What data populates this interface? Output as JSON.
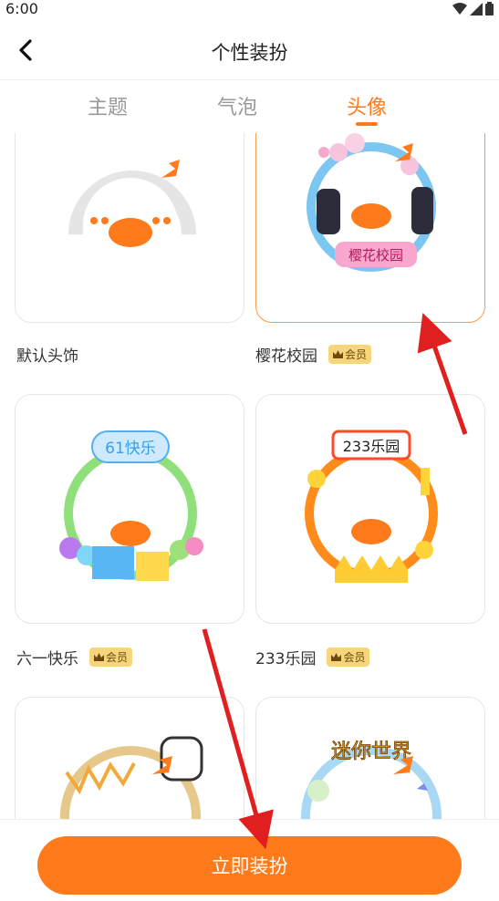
{
  "status_bar": {
    "time": "6:00"
  },
  "app_bar": {
    "title": "个性装扮"
  },
  "tabs": [
    {
      "label": "主题",
      "active": false
    },
    {
      "label": "气泡",
      "active": false
    },
    {
      "label": "头像",
      "active": true
    }
  ],
  "items": [
    {
      "name": "默认头饰",
      "vip": false,
      "selected": false,
      "ring_text": ""
    },
    {
      "name": "樱花校园",
      "vip": true,
      "selected": true,
      "ring_text": "樱花校园"
    },
    {
      "name": "六一快乐",
      "vip": true,
      "selected": false,
      "ring_text": "61快乐"
    },
    {
      "name": "233乐园",
      "vip": true,
      "selected": false,
      "ring_text": "233乐园"
    },
    {
      "name": "",
      "vip": false,
      "selected": false,
      "ring_text": ""
    },
    {
      "name": "",
      "vip": false,
      "selected": false,
      "ring_text": "迷你世界"
    }
  ],
  "vip_label": "会员",
  "apply_button": {
    "label": "立即装扮"
  },
  "colors": {
    "accent": "#ff7a1a",
    "vip_badge": "#f7d57a",
    "arrow": "#e02020"
  }
}
